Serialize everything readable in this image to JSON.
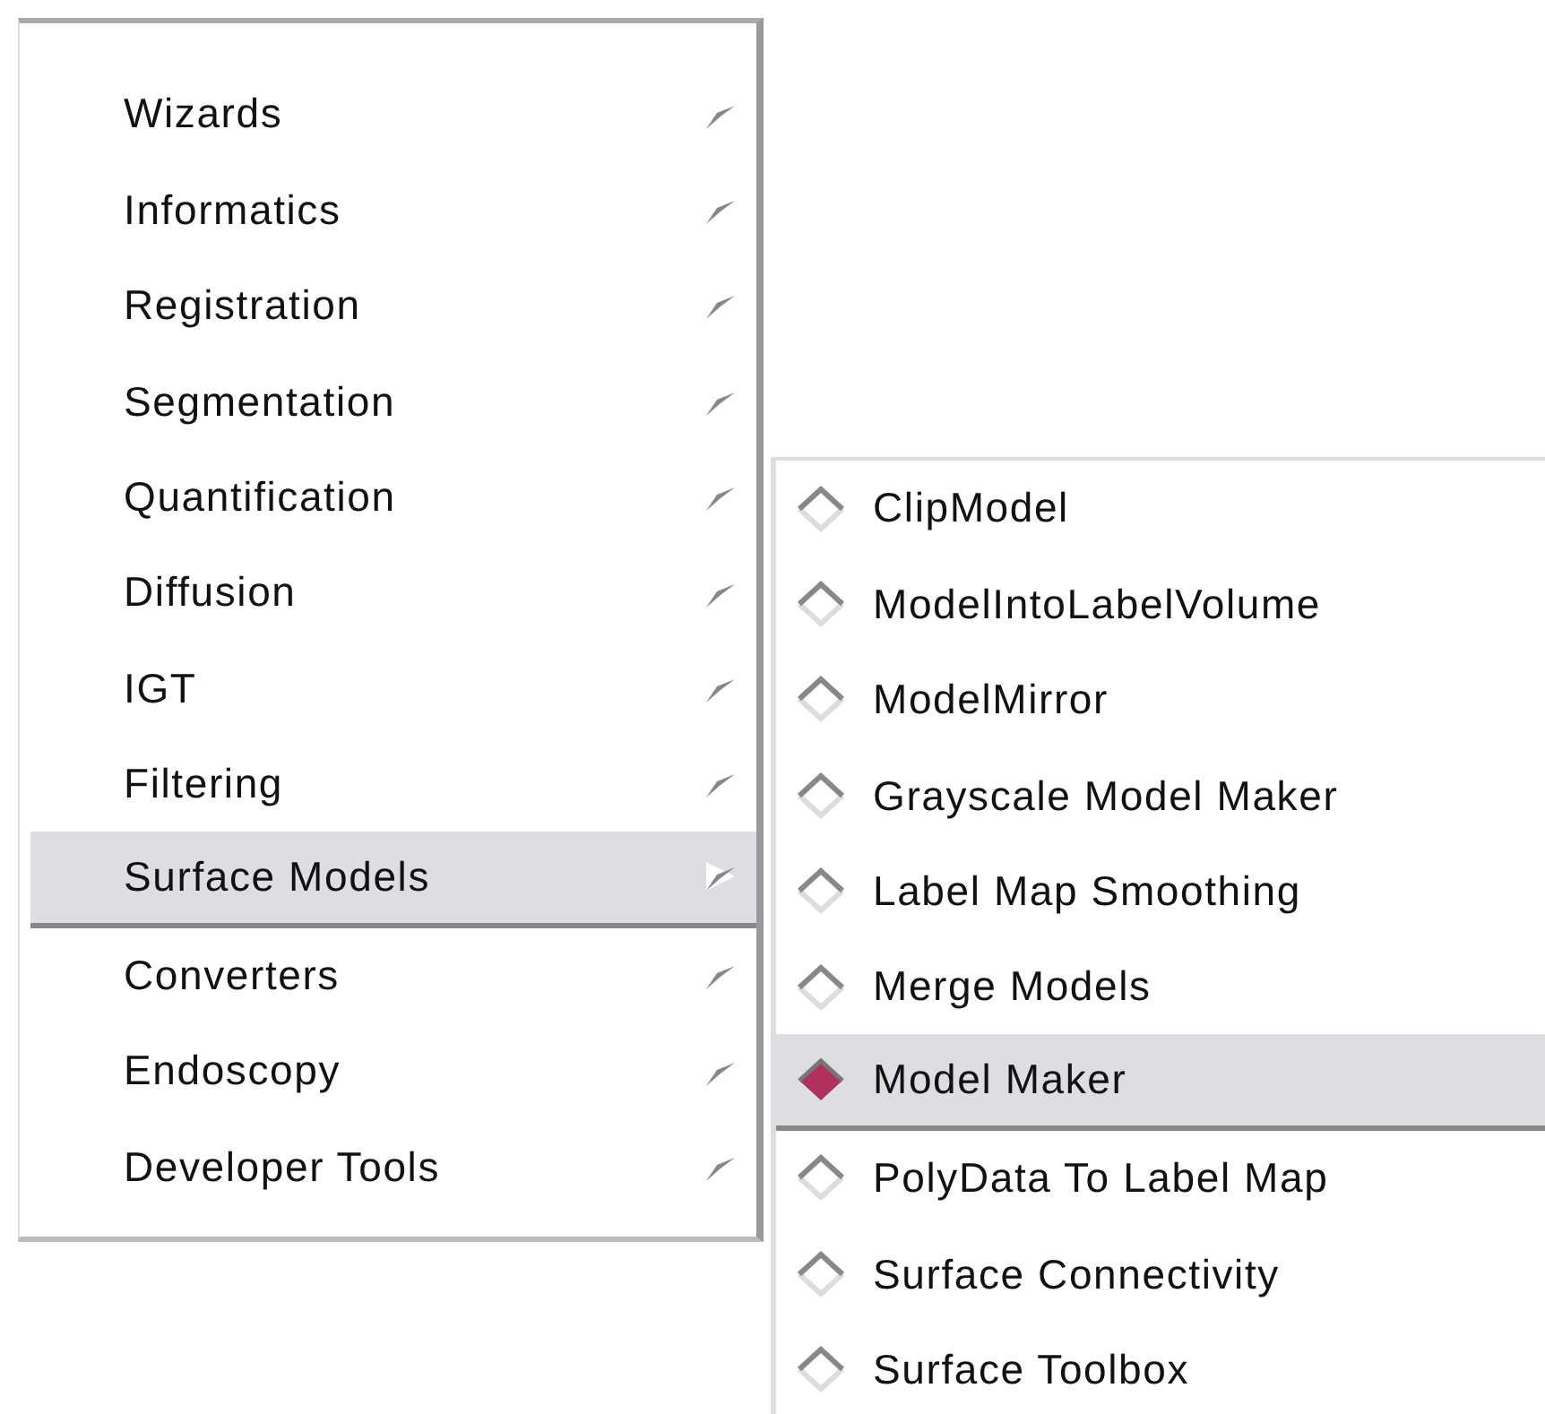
{
  "main_menu": {
    "items": [
      {
        "label": "Wizards",
        "selected": false
      },
      {
        "label": "Informatics",
        "selected": false
      },
      {
        "label": "Registration",
        "selected": false
      },
      {
        "label": "Segmentation",
        "selected": false
      },
      {
        "label": "Quantification",
        "selected": false
      },
      {
        "label": "Diffusion",
        "selected": false
      },
      {
        "label": "IGT",
        "selected": false
      },
      {
        "label": "Filtering",
        "selected": false
      },
      {
        "label": "Surface Models",
        "selected": true
      },
      {
        "label": "Converters",
        "selected": false
      },
      {
        "label": "Endoscopy",
        "selected": false
      },
      {
        "label": "Developer Tools",
        "selected": false
      }
    ]
  },
  "submenu": {
    "items": [
      {
        "label": "ClipModel",
        "selected": false
      },
      {
        "label": "ModelIntoLabelVolume",
        "selected": false
      },
      {
        "label": "ModelMirror",
        "selected": false
      },
      {
        "label": "Grayscale Model Maker",
        "selected": false
      },
      {
        "label": "Label Map Smoothing",
        "selected": false
      },
      {
        "label": "Merge Models",
        "selected": false
      },
      {
        "label": "Model Maker",
        "selected": true
      },
      {
        "label": "PolyData To Label Map",
        "selected": false
      },
      {
        "label": "Surface Connectivity",
        "selected": false
      },
      {
        "label": "Surface Toolbox",
        "selected": false
      }
    ]
  }
}
